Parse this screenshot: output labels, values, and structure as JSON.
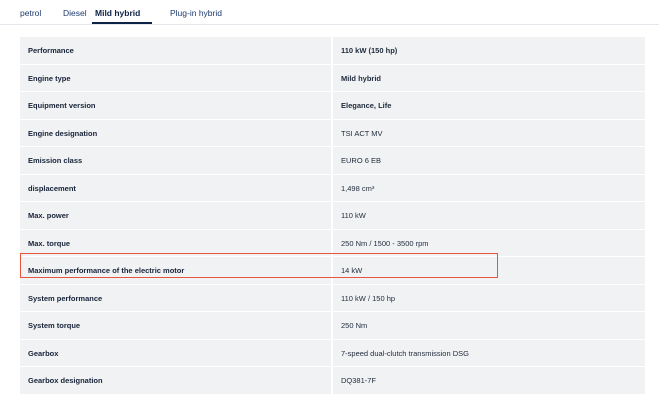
{
  "tabs": [
    {
      "label": "petrol"
    },
    {
      "label": "Diesel"
    },
    {
      "label": "Mild hybrid",
      "active": true
    },
    {
      "label": "Plug-in hybrid"
    }
  ],
  "specs": [
    {
      "label": "Performance",
      "value": "110 kW (150 hp)",
      "value_bold": true
    },
    {
      "label": "Engine type",
      "value": "Mild hybrid",
      "value_bold": true
    },
    {
      "label": "Equipment version",
      "value": "Elegance, Life",
      "value_bold": true
    },
    {
      "label": "Engine designation",
      "value": "TSI ACT MV"
    },
    {
      "label": "Emission class",
      "value": "EURO 6 EB"
    },
    {
      "label": "displacement",
      "value": "1,498 cm³"
    },
    {
      "label": "Max. power",
      "value": "110 kW"
    },
    {
      "label": "Max. torque",
      "value": "250 Nm / 1500 - 3500 rpm"
    },
    {
      "label": "Maximum performance of the electric motor",
      "value": "14 kW",
      "highlighted": true
    },
    {
      "label": "System performance",
      "value": "110 kW / 150 hp"
    },
    {
      "label": "System torque",
      "value": "250 Nm"
    },
    {
      "label": "Gearbox",
      "value": "7-speed dual-clutch transmission DSG"
    },
    {
      "label": "Gearbox designation",
      "value": "DQ381-7F"
    }
  ],
  "colors": {
    "highlight_border": "#e8553c",
    "row_background": "#f1f2f4",
    "active_tab": "#0c2247"
  }
}
